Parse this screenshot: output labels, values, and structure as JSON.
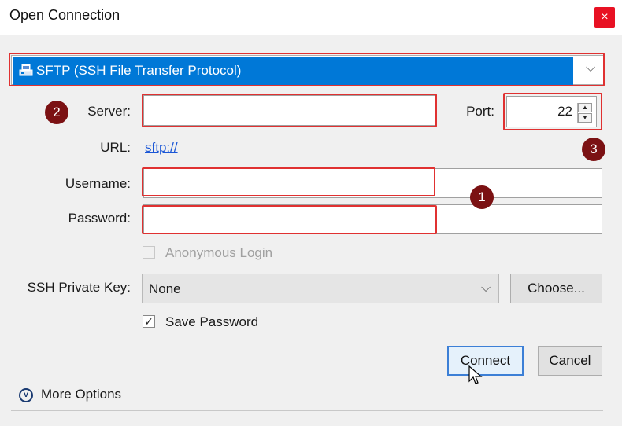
{
  "window": {
    "title": "Open Connection",
    "close_symbol": "×"
  },
  "protocol": {
    "selected": "SFTP (SSH File Transfer Protocol)"
  },
  "server": {
    "label": "Server:",
    "value": ""
  },
  "port": {
    "label": "Port:",
    "value": "22"
  },
  "url": {
    "label": "URL:",
    "value": "sftp://"
  },
  "username": {
    "label": "Username:",
    "value": ""
  },
  "password": {
    "label": "Password:",
    "value": ""
  },
  "anonymous_login": {
    "label": "Anonymous Login",
    "checked": false,
    "enabled": false
  },
  "ssh_key": {
    "label": "SSH Private Key:",
    "value": "None",
    "choose_label": "Choose..."
  },
  "save_password": {
    "label": "Save Password",
    "checked": true
  },
  "buttons": {
    "connect": "Connect",
    "cancel": "Cancel"
  },
  "more_options": {
    "label": "More Options"
  },
  "annotations": {
    "badge_1": "1",
    "badge_2": "2",
    "badge_3": "3",
    "badge_color": "#7b1113",
    "highlight_color": "#e03131"
  },
  "colors": {
    "selection": "#0078d7",
    "link": "#1a56d6",
    "close": "#e81123"
  }
}
